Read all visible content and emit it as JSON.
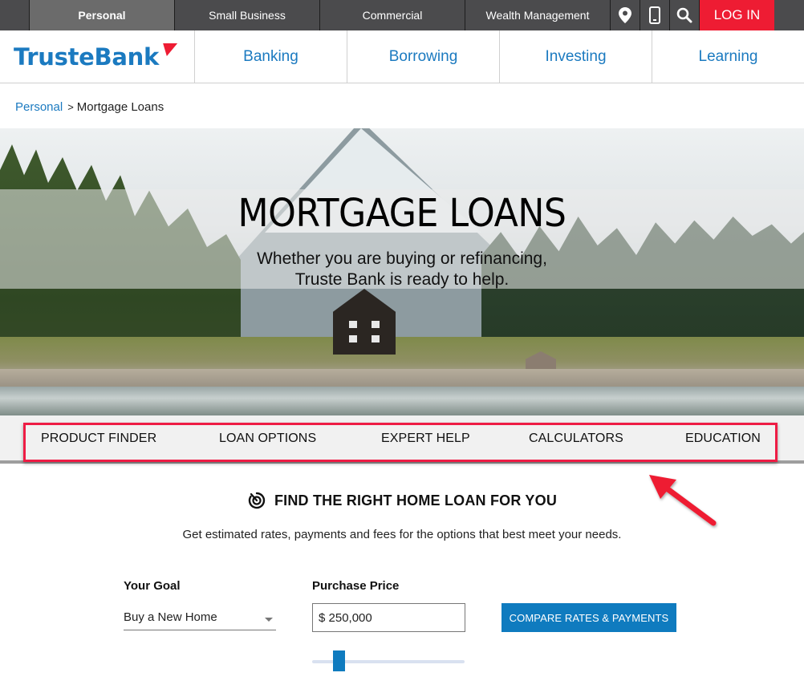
{
  "topbar": {
    "segments": [
      {
        "label": "Personal",
        "active": true
      },
      {
        "label": "Small Business",
        "active": false
      },
      {
        "label": "Commercial",
        "active": false
      },
      {
        "label": "Wealth Management",
        "active": false
      }
    ],
    "icons": [
      "location-pin-icon",
      "mobile-phone-icon",
      "search-icon"
    ],
    "login_label": "LOG IN"
  },
  "brand": {
    "name": "TrusteBank",
    "primary_color": "#1b7ac0",
    "accent_color": "#ee1c33"
  },
  "mainnav": {
    "items": [
      "Banking",
      "Borrowing",
      "Investing",
      "Learning"
    ]
  },
  "breadcrumb": {
    "parent": "Personal",
    "separator": ">",
    "current": "Mortgage Loans"
  },
  "hero": {
    "title": "MORTGAGE LOANS",
    "subtitle_line1": "Whether you are buying or refinancing,",
    "subtitle_line2": "Truste Bank is ready to help."
  },
  "subnav": {
    "items": [
      "PRODUCT FINDER",
      "LOAN OPTIONS",
      "EXPERT HELP",
      "CALCULATORS",
      "EDUCATION"
    ],
    "highlight_color": "#ee1c44"
  },
  "finder": {
    "icon": "target-clock-icon",
    "title": "FIND THE RIGHT HOME LOAN FOR YOU",
    "description": "Get estimated rates, payments and fees for the options that best meet your needs.",
    "goal_label": "Your Goal",
    "goal_value": "Buy a New Home",
    "price_label": "Purchase Price",
    "price_value": "$ 250,000",
    "slider_fraction": 0.15,
    "compare_label": "COMPARE RATES & PAYMENTS"
  }
}
